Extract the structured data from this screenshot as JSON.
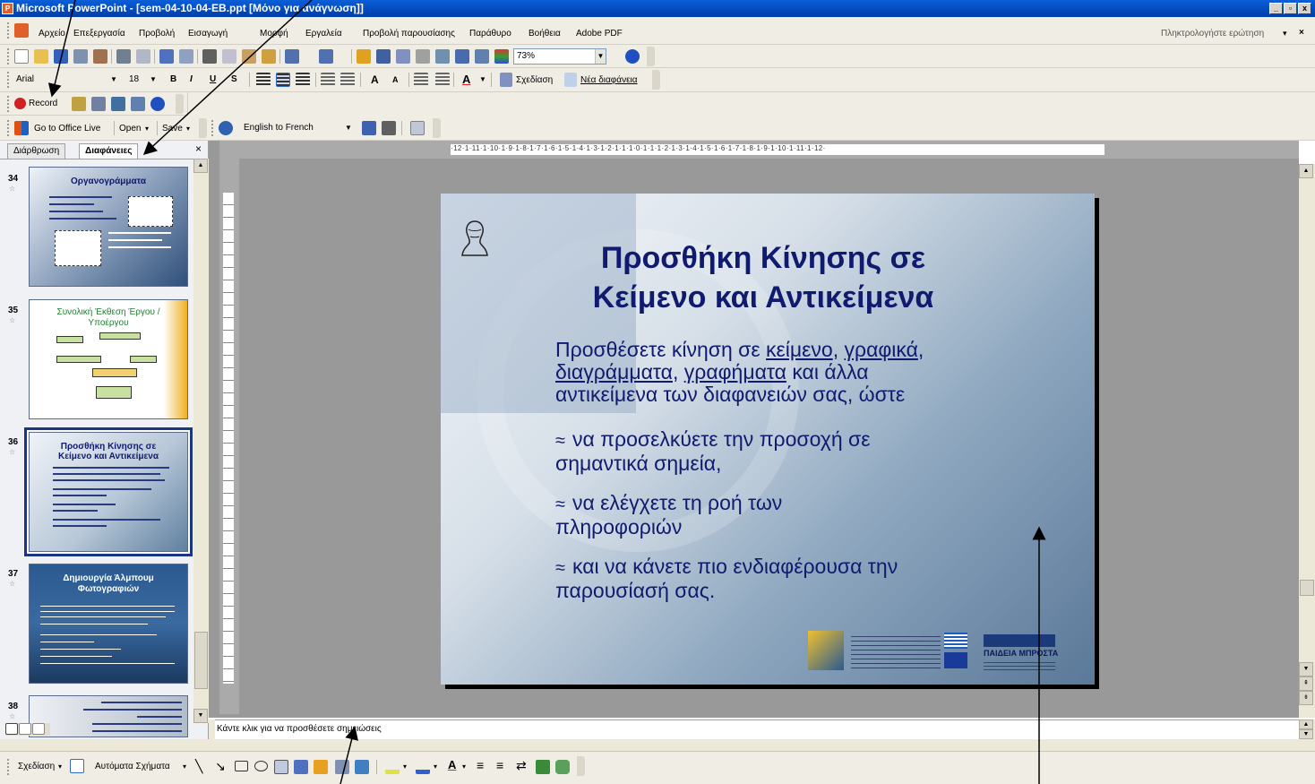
{
  "title_bar": {
    "title": "Microsoft PowerPoint - [sem-04-10-04-EB.ppt [Μόνο για ανάγνωση]]",
    "app_icon_letter": "P"
  },
  "window_buttons": {
    "minimize": "_",
    "restore": "▫",
    "close": "x"
  },
  "menu": {
    "items": [
      "Αρχείο",
      "Επεξεργασία",
      "Προβολή",
      "Εισαγωγή",
      "Μορφή",
      "Εργαλεία",
      "Προβολή παρουσίασης",
      "Παράθυρο",
      "Βοήθεια",
      "Adobe PDF"
    ],
    "help_search_placeholder": "Πληκτρολογήστε ερώτηση",
    "close_glyph": "×"
  },
  "standard_toolbar": {
    "zoom": "73%"
  },
  "formatting_toolbar": {
    "font": "Arial",
    "size": "18",
    "bold": "B",
    "italic": "I",
    "underline": "U",
    "shadow": "S",
    "font_grow": "A",
    "font_shrink": "A",
    "font_color": "A",
    "design_label": "Σχεδίαση",
    "new_slide_label": "Νέα διαφάνεια"
  },
  "record_toolbar": {
    "record_label": "Record"
  },
  "office_live_toolbar": {
    "go_live": "Go to Office Live",
    "open": "Open",
    "save": "Save",
    "translate": "English to French"
  },
  "left_pane": {
    "tabs": [
      "Διάρθρωση",
      "Διαφάνειες"
    ],
    "active_tab": "Διαφάνειες",
    "close_glyph": "×",
    "thumbnails": [
      {
        "num": "34",
        "title": "Οργανογράμματα"
      },
      {
        "num": "35",
        "title": "Συνολική Έκθεση Έργου / Υποέργου"
      },
      {
        "num": "36",
        "title": "Προσθήκη Κίνησης σε Κείμενο και Αντικείμενα"
      },
      {
        "num": "37",
        "title": "Δημιουργία Άλμπουμ Φωτογραφιών"
      },
      {
        "num": "38",
        "title": ""
      }
    ],
    "selected": "36"
  },
  "ruler": {
    "horizontal": "·12·1·11·1·10·1·9·1·8·1·7·1·6·1·5·1·4·1·3·1·2·1·1·1·0·1·1·1·2·1·3·1·4·1·5·1·6·1·7·1·8·1·9·1·10·1·11·1·12·",
    "vertical": [
      "9",
      "8",
      "7",
      "6",
      "5",
      "4",
      "3",
      "2",
      "1",
      "0",
      "1",
      "2",
      "3",
      "4",
      "5",
      "6",
      "7",
      "8",
      "9"
    ]
  },
  "slide": {
    "title_line1": "Προσθήκη Κίνησης σε",
    "title_line2": "Κείμενο και Αντικείμενα",
    "intro": {
      "t1": "Προσθέσετε κίνηση σε ",
      "l1": "κείμενο",
      "t2": ", ",
      "l2": "γραφικά",
      "t3": ",",
      "l3": "διαγράμματα",
      "t4": ", ",
      "l4": "γραφήματα",
      "t5": " και άλλα",
      "t6": "αντικείμενα των διαφανειών σας, ώστε"
    },
    "bullet_glyph": "≈",
    "bullets": [
      {
        "l1": "να προσελκύετε την προσοχή σε",
        "l2": "σημαντικά σημεία,"
      },
      {
        "l1": "να ελέγχετε τη ροή των",
        "l2": "πληροφοριών"
      },
      {
        "l1": "και να κάνετε πιο ενδιαφέρουσα την",
        "l2": "παρουσίασή σας."
      }
    ],
    "footer_logo_text": "ΠΑΙΔΕΙΑ ΜΠΡΟΣΤΑ"
  },
  "notes": {
    "placeholder": "Κάντε κλικ για να προσθέσετε σημειώσεις"
  },
  "drawing_toolbar": {
    "draw_label": "Σχεδίαση",
    "autoshapes_label": "Αυτόματα Σχήματα",
    "font_color": "A"
  },
  "colors": {
    "titlebar": "#0a5fd8",
    "toolbar_bg": "#f0eee4",
    "slide_text": "#101a6e",
    "record_red": "#d02020"
  }
}
